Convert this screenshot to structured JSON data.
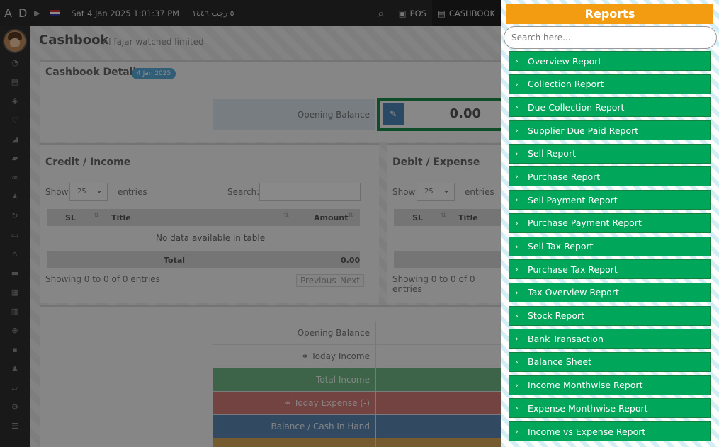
{
  "topbar": {
    "brand": "A D",
    "date": "Sat 4 Jan 2025 1:01:37 PM",
    "hijri": "٥ رجب ١٤٤٦",
    "pos_label": "POS",
    "cashbook_label": "CASHBOOK"
  },
  "sidebar": {
    "icons": [
      "dashboard-icon",
      "document-icon",
      "tags-icon",
      "heart-icon",
      "chart-icon",
      "bag-icon",
      "link-icon",
      "star-icon",
      "refresh-icon",
      "money-icon",
      "bank-icon",
      "minus-icon",
      "gift-icon",
      "file-icon",
      "zoom-icon",
      "comment-icon",
      "users-icon",
      "print-icon",
      "gear-icon",
      "list-icon"
    ]
  },
  "page": {
    "title": "Cashbook",
    "subtitle": "Al fajar watched limited"
  },
  "details": {
    "title": "Cashbook Details",
    "badge": "4 Jan 2025",
    "opening_label": "Opening Balance",
    "opening_value": "0.00"
  },
  "credit": {
    "title": "Credit / Income",
    "show_label": "Show",
    "entries_value": "25",
    "entries_label": "entries",
    "search_label": "Search:",
    "col_sl": "SL",
    "col_title": "Title",
    "col_amount": "Amount",
    "empty": "No data available in table",
    "total_label": "Total",
    "total_value": "0.00",
    "showing": "Showing 0 to 0 of 0 entries",
    "prev": "Previous",
    "next": "Next"
  },
  "debit": {
    "title": "Debit / Expense",
    "show_label": "Show",
    "entries_value": "25",
    "entries_label": "entries",
    "col_sl": "SL",
    "col_title": "Title",
    "showing": "Showing 0 to 0 of 0 entries"
  },
  "summary": {
    "opening": "Opening Balance",
    "today_income": "Today Income",
    "total_income": "Total Income",
    "today_expense": "Today Expense (-)",
    "balance": "Balance / Cash In Hand"
  },
  "reports": {
    "title": "Reports",
    "search_placeholder": "Search here...",
    "items": [
      "Overview Report",
      "Collection Report",
      "Due Collection Report",
      "Supplier Due Paid Report",
      "Sell Report",
      "Purchase Report",
      "Sell Payment Report",
      "Purchase Payment Report",
      "Sell Tax Report",
      "Purchase Tax Report",
      "Tax Overview Report",
      "Stock Report",
      "Bank Transaction",
      "Balance Sheet",
      "Income Monthwise Report",
      "Expense Monthwise Report",
      "Income vs Expense Report"
    ]
  }
}
